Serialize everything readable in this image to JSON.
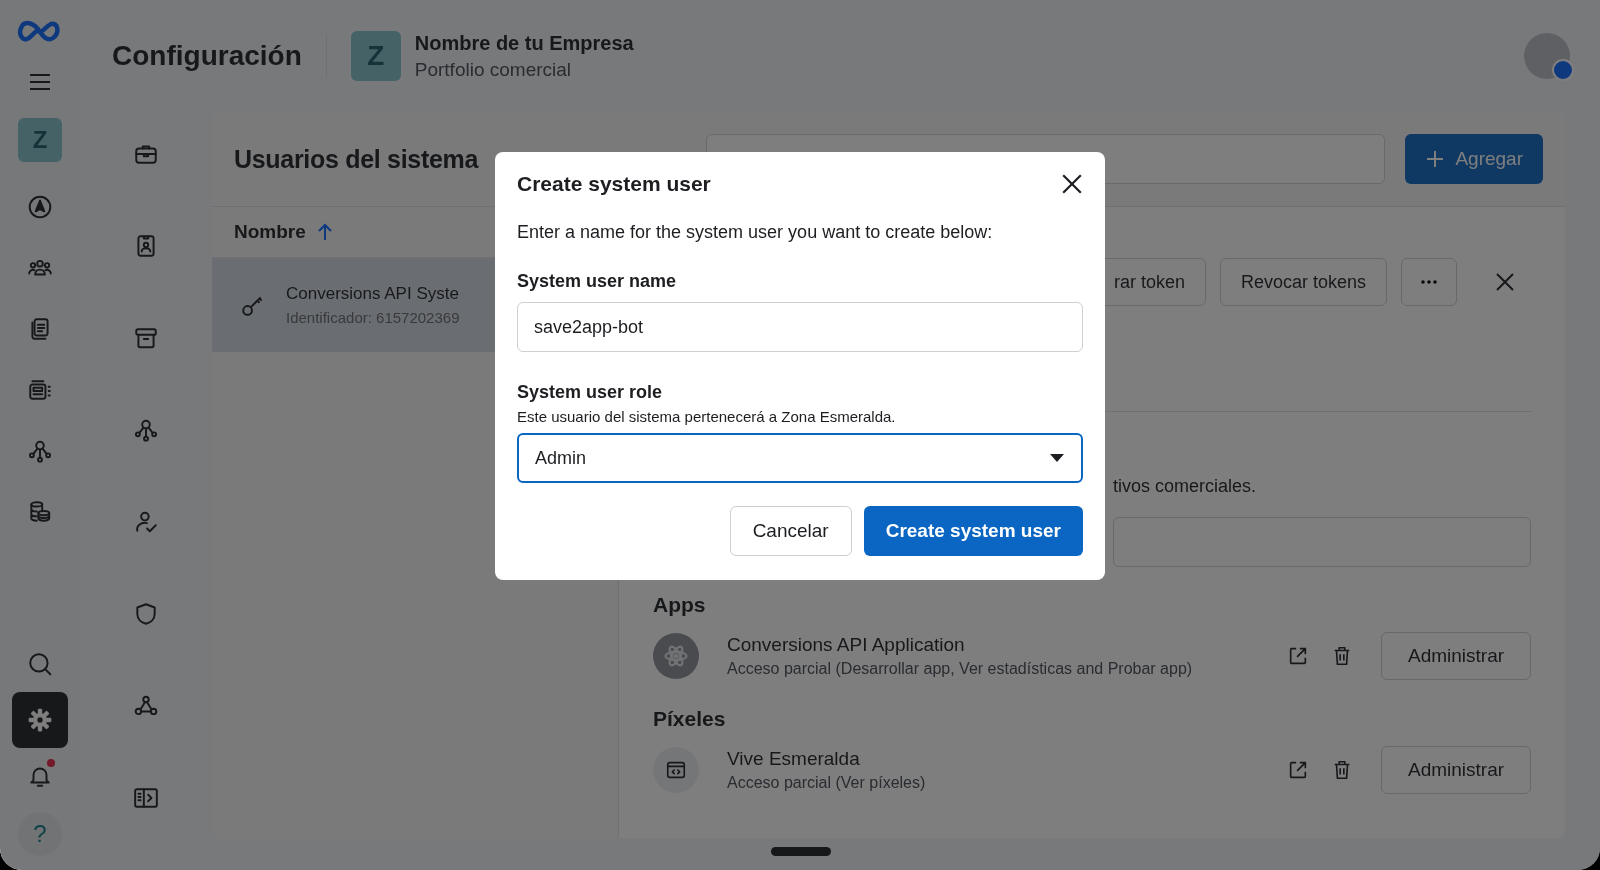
{
  "rail": {
    "avatar_letter": "Z",
    "help_label": "?",
    "items": [
      {
        "kind": "compass",
        "selected": false,
        "notification": false
      },
      {
        "kind": "people",
        "selected": false,
        "notification": false
      },
      {
        "kind": "documents",
        "selected": false,
        "notification": false
      },
      {
        "kind": "catalog",
        "selected": false,
        "notification": false
      },
      {
        "kind": "network",
        "selected": false,
        "notification": false
      },
      {
        "kind": "coins",
        "selected": false,
        "notification": false
      }
    ],
    "bottom_items": [
      {
        "kind": "search",
        "selected": false,
        "notification": false
      },
      {
        "kind": "gear",
        "selected": true,
        "notification": false
      },
      {
        "kind": "bell",
        "selected": false,
        "notification": true
      }
    ]
  },
  "header": {
    "title": "Configuración",
    "business": {
      "letter": "Z",
      "name": "Nombre de tu Empresa",
      "subtitle": "Portfolio comercial"
    }
  },
  "nav": [
    {
      "kind": "briefcase"
    },
    {
      "kind": "badge"
    },
    {
      "kind": "archive"
    },
    {
      "kind": "network"
    },
    {
      "kind": "person-check"
    },
    {
      "kind": "shield"
    },
    {
      "kind": "hub"
    },
    {
      "kind": "panel"
    }
  ],
  "panel": {
    "title": "Usuarios del sistema",
    "add_button": "Agregar",
    "column": "Nombre",
    "users": [
      {
        "name": "Conversions API Syste",
        "id": "Identificador: 6157202369",
        "selected": true
      }
    ],
    "detail": {
      "actions": [
        "rar token",
        "Revocar tokens"
      ],
      "intro": "tivos comerciales.",
      "sections": [
        {
          "title": "Apps",
          "items": [
            {
              "kind": "app",
              "name": "Conversions API Application",
              "access": "Acceso parcial (Desarrollar app, Ver estadísticas and Probar app)",
              "button": "Administrar"
            }
          ]
        },
        {
          "title": "Píxeles",
          "items": [
            {
              "kind": "pixel",
              "name": "Vive Esmeralda",
              "access": "Acceso parcial (Ver píxeles)",
              "button": "Administrar"
            }
          ]
        }
      ]
    }
  },
  "modal": {
    "title": "Create system user",
    "description": "Enter a name for the system user you want to create below:",
    "name_label": "System user name",
    "name_value": "save2app-bot",
    "role_label": "System user role",
    "role_help": "Este usuario del sistema pertenecerá a Zona Esmeralda.",
    "role_value": "Admin",
    "cancel": "Cancelar",
    "submit": "Create system user"
  }
}
